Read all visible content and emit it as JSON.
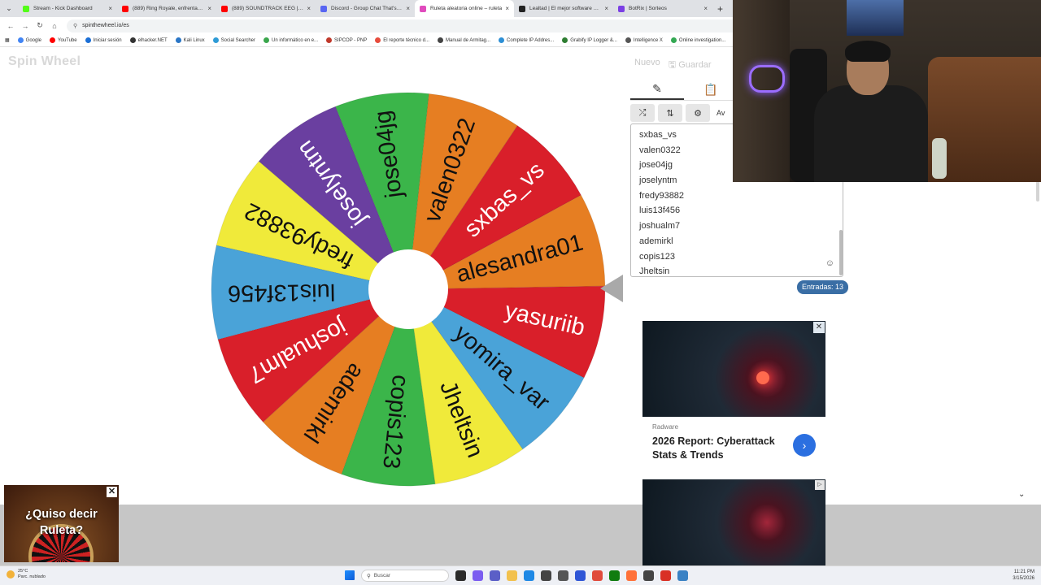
{
  "browser": {
    "tabs": [
      {
        "title": "Stream - Kick Dashboard",
        "color": "#53fc18",
        "active": false
      },
      {
        "title": "(889) Ring Royale, enfrentamien",
        "color": "#ff0000",
        "active": false
      },
      {
        "title": "(889) SOUNDTRACK EEG | GAN",
        "color": "#ff0000",
        "active": false
      },
      {
        "title": "Discord - Group Chat That's All",
        "color": "#5865f2",
        "active": false
      },
      {
        "title": "Ruleta aleatoria online – ruleta",
        "color": "#e04bbd",
        "active": true
      },
      {
        "title": "Lealtad | El mejor software para",
        "color": "#222222",
        "active": false
      },
      {
        "title": "BotRix | Sorteos",
        "color": "#7b3fe4",
        "active": false
      }
    ],
    "url": "spinthewheel.io/es",
    "bookmarks": [
      {
        "label": "Google",
        "color": "#4285f4"
      },
      {
        "label": "YouTube",
        "color": "#ff0000"
      },
      {
        "label": "Iniciar sesión",
        "color": "#1b6fd6"
      },
      {
        "label": "elhacker.NET",
        "color": "#333333"
      },
      {
        "label": "Kali Linux",
        "color": "#2a76c6"
      },
      {
        "label": "Social Searcher",
        "color": "#2e9bd6"
      },
      {
        "label": "Un informático en e...",
        "color": "#3aa64c"
      },
      {
        "label": "SIPCOP - PNP",
        "color": "#c0392b"
      },
      {
        "label": "El reporte técnico d...",
        "color": "#e74c3c"
      },
      {
        "label": "Manual de Armitag...",
        "color": "#444444"
      },
      {
        "label": "Complete IP Addres...",
        "color": "#2d8fd5"
      },
      {
        "label": "Grabify IP Logger &...",
        "color": "#2e7d32"
      },
      {
        "label": "Intelligence X",
        "color": "#555555"
      },
      {
        "label": "Online investigation...",
        "color": "#34a853"
      }
    ]
  },
  "app": {
    "logo": "Spin Wheel",
    "new_label": "Nuevo",
    "save_label": "Guardar",
    "tool_more": "Av",
    "entries_count": "Entradas: 13"
  },
  "wheel": {
    "segments": [
      {
        "label": "valen0322",
        "color": "#e67e22"
      },
      {
        "label": "sxbas_vs",
        "color": "#d91f2a"
      },
      {
        "label": "alesandra01",
        "color": "#e67e22"
      },
      {
        "label": "yasuriib",
        "color": "#d91f2a"
      },
      {
        "label": "yomira_var",
        "color": "#4aa3d8"
      },
      {
        "label": "Jheltsin",
        "color": "#f0ea3a"
      },
      {
        "label": "copis123",
        "color": "#3bb54a"
      },
      {
        "label": "ademirkl",
        "color": "#e67e22"
      },
      {
        "label": "joshualm7",
        "color": "#d91f2a"
      },
      {
        "label": "luis13f456",
        "color": "#4aa3d8"
      },
      {
        "label": "fredy93882",
        "color": "#f0ea3a"
      },
      {
        "label": "joselyntm",
        "color": "#6a3fa0"
      },
      {
        "label": "jose04jg",
        "color": "#3bb54a"
      }
    ]
  },
  "entries": [
    "sxbas_vs",
    "valen0322",
    "jose04jg",
    "joselyntm",
    "fredy93882",
    "luis13f456",
    "joshualm7",
    "ademirkl",
    "copis123",
    "Jheltsin"
  ],
  "ad": {
    "brand": "Radware",
    "title": "2026 Report: Cyberattack Stats & Trends"
  },
  "popup": {
    "text": "¿Quiso decir Ruleta?"
  },
  "taskbar": {
    "temp": "25°C",
    "weather": "Parc. nublado",
    "search_placeholder": "Buscar",
    "time": "11:21 PM",
    "date": "3/15/2026"
  }
}
